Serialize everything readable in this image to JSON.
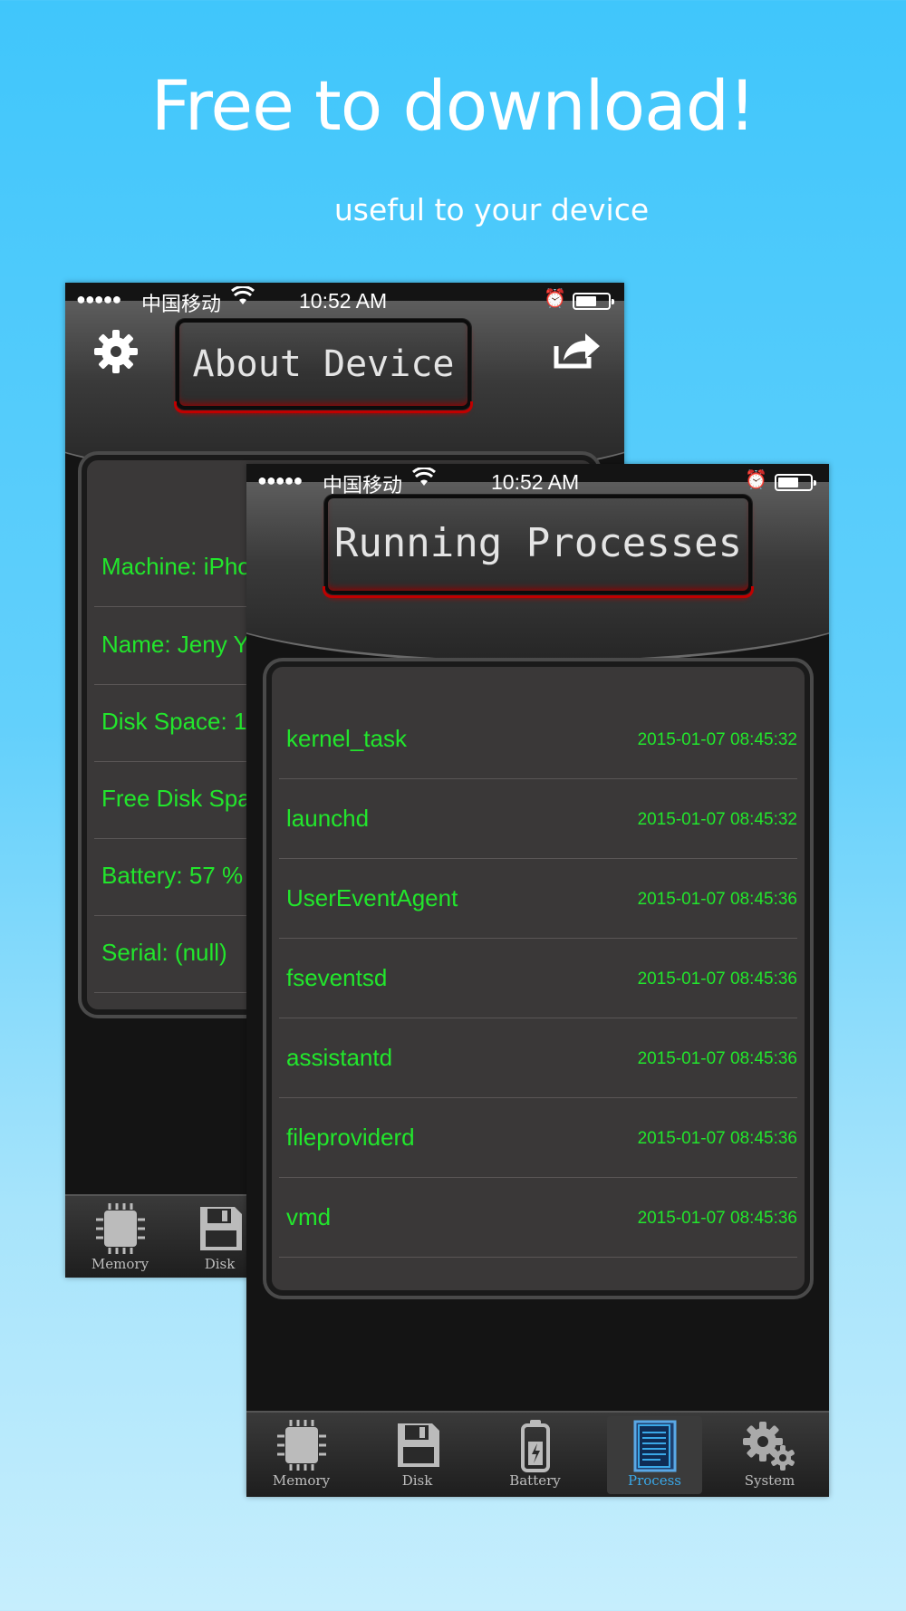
{
  "promo": {
    "headline": "Free to download!",
    "subline": "useful to your device"
  },
  "status_bar": {
    "dots": "●●●●●",
    "carrier": "中国移动",
    "time": "10:52 AM"
  },
  "about_screen": {
    "title": "About Device",
    "rows": [
      {
        "label": "Machine: iPho"
      },
      {
        "label": "Name: Jeny Yo"
      },
      {
        "label": "Disk Space: 1"
      },
      {
        "label": "Free Disk Spa"
      },
      {
        "label": "Battery: 57 %"
      },
      {
        "label": "Serial: (null)"
      }
    ],
    "tabs": [
      {
        "label": "Memory"
      },
      {
        "label": "Disk"
      }
    ]
  },
  "process_screen": {
    "title": "Running Processes",
    "processes": [
      {
        "name": "kernel_task",
        "date": "2015-01-07 08:45:32"
      },
      {
        "name": "launchd",
        "date": "2015-01-07 08:45:32"
      },
      {
        "name": "UserEventAgent",
        "date": "2015-01-07 08:45:36"
      },
      {
        "name": "fseventsd",
        "date": "2015-01-07 08:45:36"
      },
      {
        "name": "assistantd",
        "date": "2015-01-07 08:45:36"
      },
      {
        "name": "fileproviderd",
        "date": "2015-01-07 08:45:36"
      },
      {
        "name": "vmd",
        "date": "2015-01-07 08:45:36"
      }
    ],
    "tabs": [
      {
        "label": "Memory",
        "icon": "chip-icon"
      },
      {
        "label": "Disk",
        "icon": "floppy-disk-icon"
      },
      {
        "label": "Battery",
        "icon": "battery-icon"
      },
      {
        "label": "Process",
        "icon": "document-icon",
        "active": true
      },
      {
        "label": "System",
        "icon": "gears-icon"
      }
    ]
  },
  "colors": {
    "background_top": "#40c6fb",
    "background_bottom": "#c6eefd",
    "row_text": "#22e62c",
    "active_tab": "#3aa8e8",
    "title_glow": "#b00000"
  }
}
